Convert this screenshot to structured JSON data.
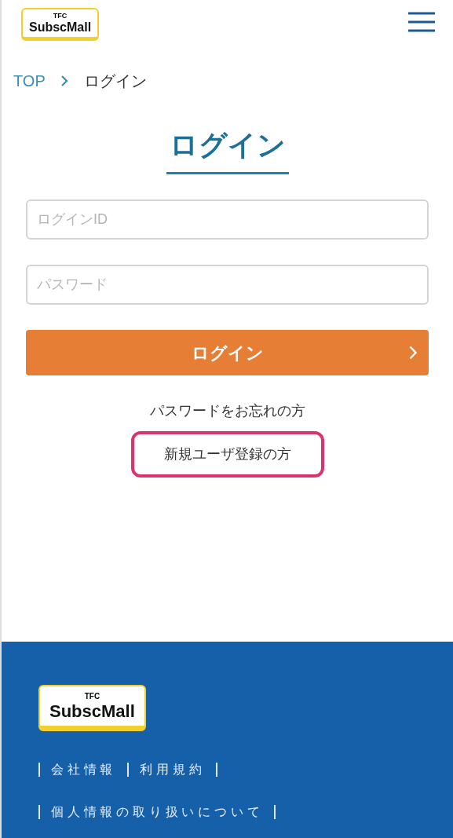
{
  "header": {
    "logo": {
      "small": "TFC",
      "name": "SubscMall"
    }
  },
  "breadcrumb": [
    {
      "label": "TOP",
      "link": true
    },
    {
      "label": "ログイン",
      "link": false
    }
  ],
  "title": "ログイン",
  "fields": [
    {
      "placeholder": "ログインID"
    },
    {
      "placeholder": "パスワード"
    }
  ],
  "login_button": "ログイン",
  "links": [
    {
      "label": "パスワードをお忘れの方",
      "highlighted": false
    },
    {
      "label": "新規ユーザ登録の方",
      "highlighted": true
    }
  ],
  "footer": {
    "logo": {
      "small": "TFC",
      "name": "SubscMall"
    },
    "link_rows": [
      [
        "会社情報",
        "利用規約"
      ],
      [
        "個人情報の取り扱いについて"
      ]
    ]
  }
}
